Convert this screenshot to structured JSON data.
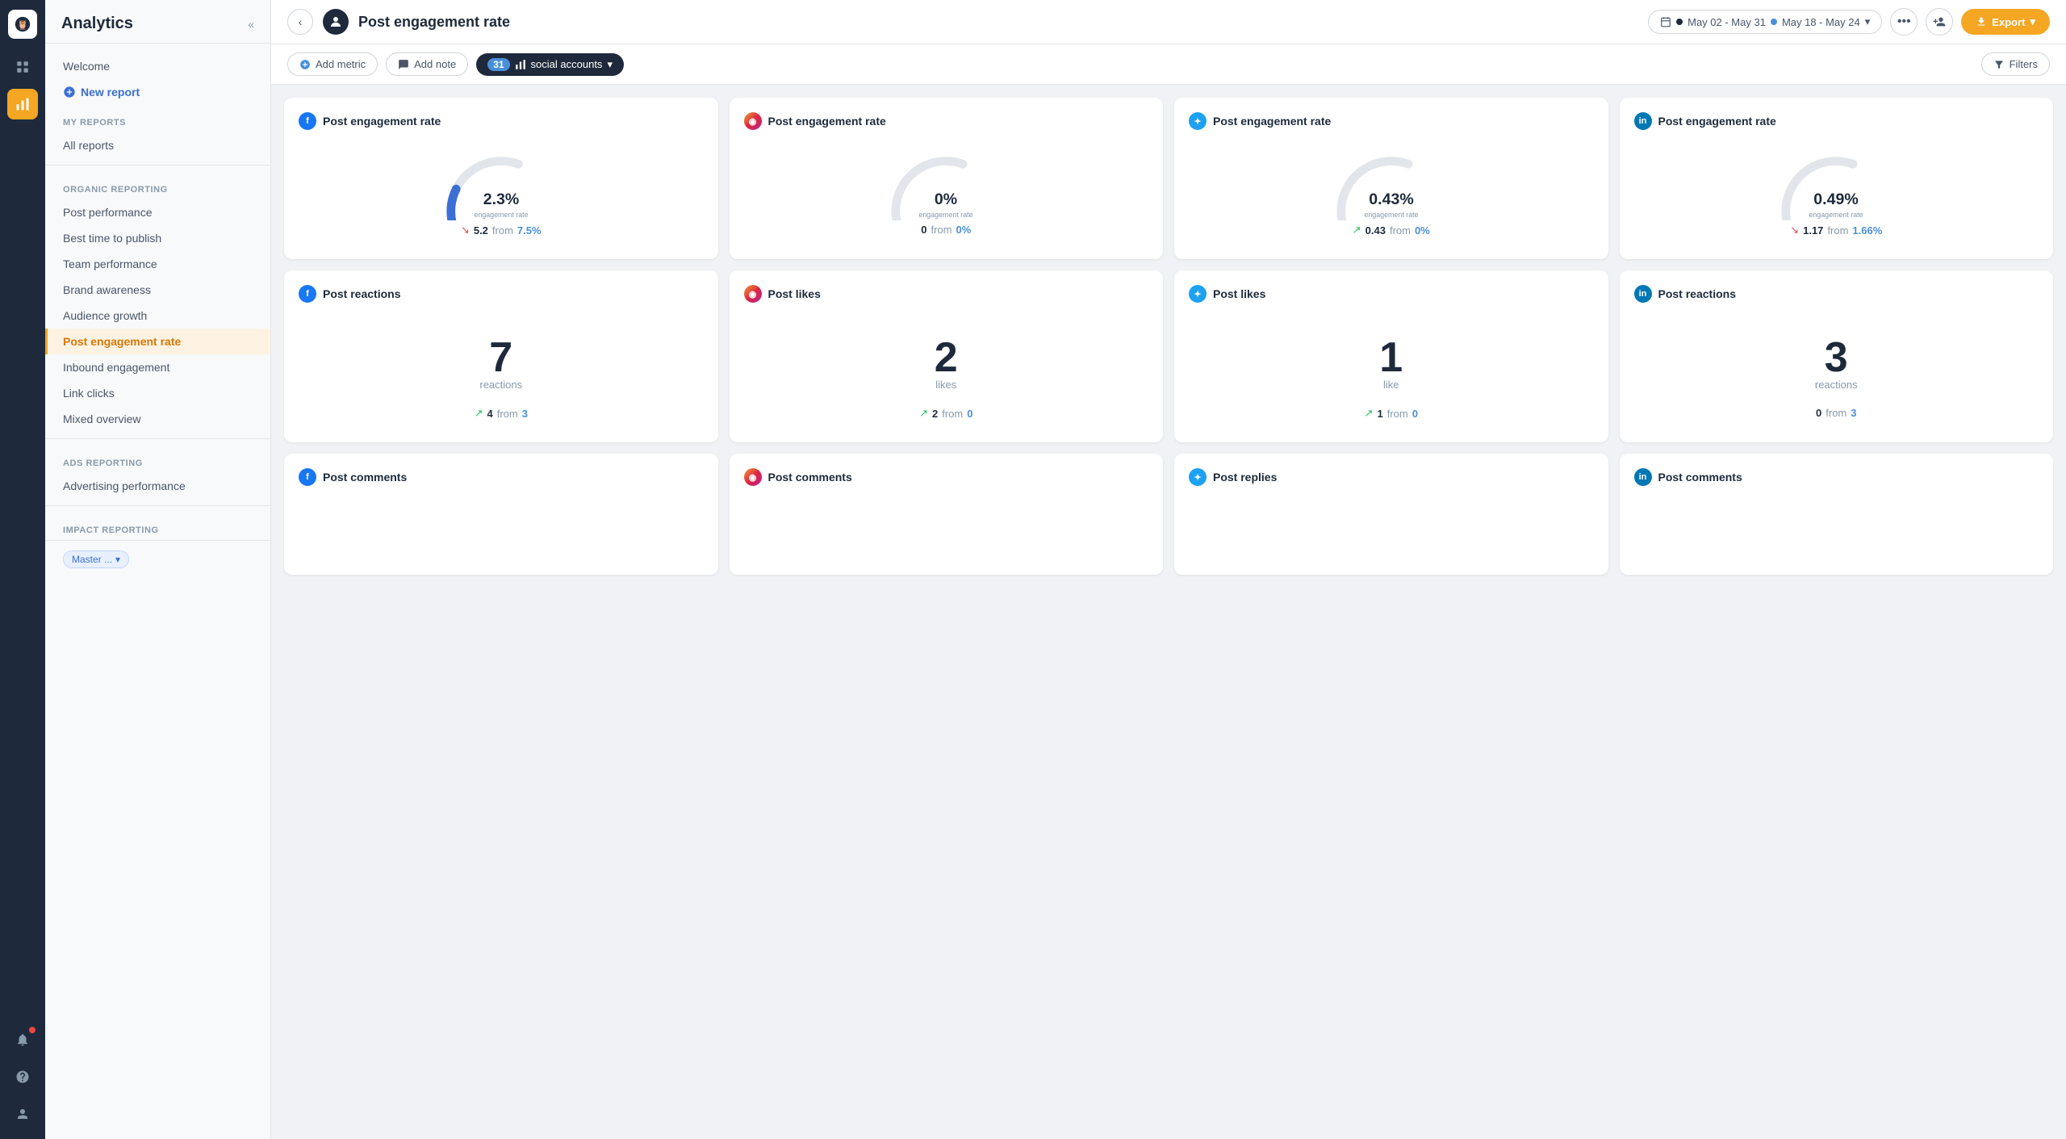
{
  "app": {
    "logo_text": "🦉",
    "icon_bar": {
      "items": [
        {
          "name": "home-icon",
          "symbol": "⊞",
          "active": false
        },
        {
          "name": "chart-icon",
          "symbol": "📊",
          "active": true
        },
        {
          "name": "bell-icon",
          "symbol": "🔔",
          "active": false,
          "has_notif": true
        },
        {
          "name": "question-icon",
          "symbol": "?",
          "active": false
        },
        {
          "name": "user-icon",
          "symbol": "👤",
          "active": false
        }
      ]
    }
  },
  "sidebar": {
    "title": "Analytics",
    "welcome_link": "Welcome",
    "my_reports_label": "MY REPORTS",
    "all_reports_link": "All reports",
    "new_report_label": "New report",
    "organic_label": "ORGANIC REPORTING",
    "organic_links": [
      "Post performance",
      "Best time to publish",
      "Team performance",
      "Brand awareness",
      "Audience growth",
      "Post engagement rate",
      "Inbound engagement",
      "Link clicks",
      "Mixed overview"
    ],
    "active_link": "Post engagement rate",
    "ads_label": "ADS REPORTING",
    "ads_links": [
      "Advertising performance"
    ],
    "impact_label": "IMPACT REPORTING",
    "impact_badge": "Master ...",
    "impact_badge_arrow": "▾"
  },
  "topbar": {
    "title": "Post engagement rate",
    "back_btn": "‹",
    "date_range_primary": "May 02 - May 31",
    "date_range_secondary": "May 18 - May 24",
    "more_label": "•••",
    "export_label": "Export",
    "export_arrow": "▾"
  },
  "toolbar": {
    "add_metric_label": "Add metric",
    "add_note_label": "Add note",
    "social_count": "31",
    "social_label": "social accounts",
    "social_arrow": "▾",
    "filter_label": "Filters"
  },
  "cards": [
    {
      "platform": "fb",
      "platform_symbol": "f",
      "title": "Post engagement rate",
      "type": "gauge",
      "value": "2.3%",
      "label": "engagement rate",
      "gauge_fill": 0.62,
      "gauge_color": "#3b6fd4",
      "comp_direction": "down",
      "comp_value": "5.2",
      "comp_from": "from",
      "comp_prev": "7.5%"
    },
    {
      "platform": "ig",
      "platform_symbol": "◎",
      "title": "Post engagement rate",
      "type": "gauge",
      "value": "0%",
      "label": "engagement rate",
      "gauge_fill": 0.0,
      "gauge_color": "#cccccc",
      "comp_direction": "neutral",
      "comp_value": "0",
      "comp_from": "from",
      "comp_prev": "0%"
    },
    {
      "platform": "tw",
      "platform_symbol": "✦",
      "title": "Post engagement rate",
      "type": "gauge",
      "value": "0.43%",
      "label": "engagement rate",
      "gauge_fill": 0.15,
      "gauge_color": "#1e2a3b",
      "comp_direction": "up",
      "comp_value": "0.43",
      "comp_from": "from",
      "comp_prev": "0%"
    },
    {
      "platform": "li",
      "platform_symbol": "in",
      "title": "Post engagement rate",
      "type": "gauge",
      "value": "0.49%",
      "label": "engagement rate",
      "gauge_fill": 0.18,
      "gauge_color": "#1e2a3b",
      "comp_direction": "down",
      "comp_value": "1.17",
      "comp_from": "from",
      "comp_prev": "1.66%"
    },
    {
      "platform": "fb",
      "platform_symbol": "f",
      "title": "Post reactions",
      "type": "count",
      "value": "7",
      "label": "reactions",
      "comp_direction": "up",
      "comp_value": "4",
      "comp_from": "from",
      "comp_prev": "3"
    },
    {
      "platform": "ig",
      "platform_symbol": "◎",
      "title": "Post likes",
      "type": "count",
      "value": "2",
      "label": "likes",
      "comp_direction": "up",
      "comp_value": "2",
      "comp_from": "from",
      "comp_prev": "0"
    },
    {
      "platform": "tw",
      "platform_symbol": "✦",
      "title": "Post likes",
      "type": "count",
      "value": "1",
      "label": "like",
      "comp_direction": "up",
      "comp_value": "1",
      "comp_from": "from",
      "comp_prev": "0"
    },
    {
      "platform": "li",
      "platform_symbol": "in",
      "title": "Post reactions",
      "type": "count",
      "value": "3",
      "label": "reactions",
      "comp_direction": "neutral",
      "comp_value": "0",
      "comp_from": "from",
      "comp_prev": "3"
    },
    {
      "platform": "fb",
      "platform_symbol": "f",
      "title": "Post comments",
      "type": "bottom"
    },
    {
      "platform": "ig",
      "platform_symbol": "◎",
      "title": "Post comments",
      "type": "bottom"
    },
    {
      "platform": "tw",
      "platform_symbol": "✦",
      "title": "Post replies",
      "type": "bottom"
    },
    {
      "platform": "li",
      "platform_symbol": "in",
      "title": "Post comments",
      "type": "bottom"
    }
  ],
  "colors": {
    "fb": "#1877f2",
    "ig_grad_start": "#f09433",
    "tw": "#1da1f2",
    "li": "#0077b5",
    "accent": "#f5a623",
    "dark": "#1e2a3b",
    "up": "#22c55e",
    "down": "#ef4444",
    "muted": "#8899aa"
  }
}
